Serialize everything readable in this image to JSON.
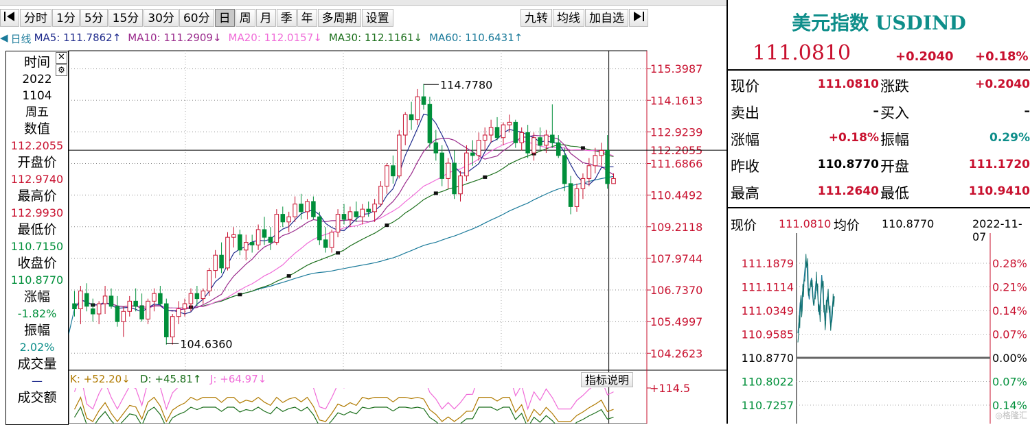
{
  "toolbar": {
    "nav_left_icon": "skip-to-start-icon",
    "periods": [
      "分时",
      "1分",
      "5分",
      "15分",
      "30分",
      "60分",
      "日",
      "周",
      "月",
      "季",
      "年",
      "多周期",
      "设置"
    ],
    "active_period": "日",
    "right_buttons": [
      "九转",
      "均线",
      "加自选"
    ],
    "nav_right_icon": "skip-to-end-icon"
  },
  "ma_legend": {
    "period_label": "日线",
    "items": [
      {
        "text": "MA5: 111.7862↑",
        "color": "#1e2a8c"
      },
      {
        "text": "MA10: 111.2909↓",
        "color": "#9a2a8c"
      },
      {
        "text": "MA20: 112.0157↓",
        "color": "#f06ad8"
      },
      {
        "text": "MA30: 112.1161↓",
        "color": "#1a6e1a"
      },
      {
        "text": "MA60: 110.6431↑",
        "color": "#1a7a9a"
      }
    ]
  },
  "info_panel": {
    "close_icon": "close-icon",
    "gear_icon": "gear-icon",
    "rows": [
      {
        "label": "时间",
        "value": "2022",
        "value_color": "#000000"
      },
      {
        "label": "",
        "value": "1104",
        "value_color": "#000000"
      },
      {
        "label": "",
        "value": "周五",
        "value_color": "#000000"
      },
      {
        "label": "数值",
        "value": "112.2055",
        "value_color": "#c8102e"
      },
      {
        "label": "开盘价",
        "value": "112.9740",
        "value_color": "#c8102e"
      },
      {
        "label": "最高价",
        "value": "112.9930",
        "value_color": "#c8102e"
      },
      {
        "label": "最低价",
        "value": "110.7150",
        "value_color": "#008f3a"
      },
      {
        "label": "收盘价",
        "value": "110.8770",
        "value_color": "#008f3a"
      },
      {
        "label": "涨幅",
        "value": "-1.82%",
        "value_color": "#008f3a"
      },
      {
        "label": "振幅",
        "value": "2.02%",
        "value_color": "#0e8e8a"
      },
      {
        "label": "成交量",
        "value": "—",
        "value_color": "#1e2a8c"
      },
      {
        "label": "成交额",
        "value": "",
        "value_color": "#000000"
      }
    ]
  },
  "price_axis_labels": [
    "115.3987",
    "114.1613",
    "112.9239",
    "112.2055",
    "111.6866",
    "110.4492",
    "109.2118",
    "107.9744",
    "106.7370",
    "105.4997",
    "104.2623"
  ],
  "lower_axis_label": "+114.5",
  "indicator_button": "指标说明",
  "kdj_legend": [
    {
      "text": "K: +52.20↓",
      "color": "#b07a00"
    },
    {
      "text": "D: +45.81↑",
      "color": "#1a6e1a"
    },
    {
      "text": "J: +64.97↓",
      "color": "#f06ad8"
    }
  ],
  "annotations": {
    "high": "114.7780",
    "low": "104.6360"
  },
  "price_panel": {
    "title": "美元指数 USDIND",
    "last_price": "111.0810",
    "change": "+0.2040",
    "change_pct": "+0.18%",
    "rows": [
      {
        "l1": "现价",
        "v1": "111.0810",
        "c1": "#c8102e",
        "l2": "涨跌",
        "v2": "+0.2040",
        "c2": "#c8102e"
      },
      {
        "l1": "卖出",
        "v1": "–",
        "c1": "#000000",
        "l2": "买入",
        "v2": "–",
        "c2": "#000000"
      },
      {
        "l1": "涨幅",
        "v1": "+0.18%",
        "c1": "#c8102e",
        "l2": "振幅",
        "v2": "0.29%",
        "c2": "#0e8e8a"
      },
      {
        "l1": "昨收",
        "v1": "110.8770",
        "c1": "#000000",
        "l2": "开盘",
        "v2": "111.1720",
        "c2": "#c8102e"
      },
      {
        "l1": "最高",
        "v1": "111.2640",
        "c1": "#c8102e",
        "l2": "最低",
        "v2": "110.9410",
        "c2": "#c8102e"
      }
    ],
    "minute_header": {
      "l1": "现价",
      "v1": "111.0810",
      "l2": "均价",
      "v2": "110.8770",
      "date": "2022-11-07"
    },
    "minute_left": [
      {
        "v": "111.1879",
        "c": "#c8102e"
      },
      {
        "v": "111.1114",
        "c": "#c8102e"
      },
      {
        "v": "111.0349",
        "c": "#c8102e"
      },
      {
        "v": "110.9585",
        "c": "#c8102e"
      },
      {
        "v": "110.8770",
        "c": "#000000"
      },
      {
        "v": "110.8022",
        "c": "#008f3a"
      },
      {
        "v": "110.7257",
        "c": "#008f3a"
      }
    ],
    "minute_right": [
      {
        "v": "0.28%",
        "c": "#c8102e"
      },
      {
        "v": "0.21%",
        "c": "#c8102e"
      },
      {
        "v": "0.14%",
        "c": "#c8102e"
      },
      {
        "v": "0.07%",
        "c": "#c8102e"
      },
      {
        "v": "0.00%",
        "c": "#000000"
      },
      {
        "v": "0.07%",
        "c": "#008f3a"
      },
      {
        "v": "0.14%",
        "c": "#008f3a"
      }
    ]
  },
  "chart_data": [
    {
      "type": "candlestick",
      "y_axis_ticks": [
        115.3987,
        114.1613,
        112.9239,
        111.6866,
        110.4492,
        109.2118,
        107.9744,
        106.737,
        105.4997,
        104.2623
      ],
      "ylim": [
        103.6,
        116.1
      ],
      "grid": true,
      "crosshair_value": 112.2055,
      "ohlc": [
        [
          106.2,
          106.7,
          105.7,
          106.0
        ],
        [
          106.0,
          106.9,
          105.4,
          106.7
        ],
        [
          106.6,
          107.0,
          105.9,
          106.1
        ],
        [
          106.0,
          106.4,
          105.5,
          105.8
        ],
        [
          105.8,
          106.3,
          105.4,
          106.2
        ],
        [
          106.2,
          106.9,
          105.8,
          106.5
        ],
        [
          106.5,
          106.8,
          106.0,
          106.1
        ],
        [
          106.1,
          106.5,
          105.3,
          105.5
        ],
        [
          105.5,
          106.1,
          104.9,
          105.9
        ],
        [
          105.9,
          106.5,
          105.7,
          106.3
        ],
        [
          106.3,
          106.8,
          105.9,
          106.1
        ],
        [
          106.1,
          106.6,
          105.5,
          105.6
        ],
        [
          105.6,
          106.4,
          105.4,
          106.3
        ],
        [
          106.3,
          106.8,
          105.9,
          106.6
        ],
        [
          106.6,
          106.9,
          106.1,
          106.2
        ],
        [
          106.2,
          106.4,
          104.6,
          104.9
        ],
        [
          104.9,
          105.8,
          104.6,
          105.7
        ],
        [
          105.7,
          106.3,
          105.4,
          106.0
        ],
        [
          106.0,
          106.4,
          105.7,
          106.2
        ],
        [
          106.2,
          106.8,
          105.9,
          106.6
        ],
        [
          106.6,
          106.9,
          106.1,
          106.4
        ],
        [
          106.4,
          106.8,
          106.2,
          106.7
        ],
        [
          106.7,
          107.6,
          106.5,
          107.5
        ],
        [
          107.5,
          108.3,
          107.2,
          108.1
        ],
        [
          108.1,
          108.6,
          107.4,
          107.6
        ],
        [
          107.6,
          109.0,
          107.5,
          108.8
        ],
        [
          108.8,
          109.2,
          108.4,
          108.9
        ],
        [
          108.9,
          109.1,
          108.1,
          108.3
        ],
        [
          108.3,
          108.9,
          107.9,
          108.6
        ],
        [
          108.6,
          108.9,
          108.2,
          108.5
        ],
        [
          108.5,
          109.3,
          108.3,
          109.1
        ],
        [
          109.1,
          109.6,
          108.5,
          108.8
        ],
        [
          108.8,
          109.2,
          108.3,
          108.6
        ],
        [
          108.6,
          109.9,
          108.5,
          109.7
        ],
        [
          109.7,
          110.0,
          109.2,
          109.4
        ],
        [
          109.4,
          109.8,
          109.0,
          109.6
        ],
        [
          109.6,
          110.4,
          109.4,
          110.1
        ],
        [
          110.1,
          110.5,
          109.5,
          109.8
        ],
        [
          109.8,
          110.3,
          109.5,
          110.2
        ],
        [
          110.2,
          110.4,
          109.5,
          109.6
        ],
        [
          109.6,
          109.8,
          108.5,
          108.7
        ],
        [
          108.7,
          109.2,
          108.2,
          108.4
        ],
        [
          108.4,
          109.1,
          108.2,
          109.0
        ],
        [
          109.0,
          109.9,
          108.8,
          109.7
        ],
        [
          109.7,
          110.1,
          109.3,
          109.5
        ],
        [
          109.5,
          110.0,
          109.2,
          109.8
        ],
        [
          109.8,
          110.2,
          109.4,
          109.6
        ],
        [
          109.6,
          110.1,
          109.3,
          109.9
        ],
        [
          109.9,
          110.2,
          109.6,
          109.8
        ],
        [
          109.8,
          110.3,
          109.4,
          110.1
        ],
        [
          110.1,
          111.0,
          110.0,
          110.8
        ],
        [
          110.8,
          111.7,
          110.5,
          111.6
        ],
        [
          111.6,
          112.0,
          110.9,
          111.2
        ],
        [
          111.2,
          113.0,
          111.1,
          112.8
        ],
        [
          112.8,
          113.7,
          112.4,
          113.6
        ],
        [
          113.6,
          114.1,
          113.0,
          113.4
        ],
        [
          113.4,
          114.6,
          113.2,
          114.3
        ],
        [
          114.3,
          114.8,
          113.8,
          114.0
        ],
        [
          114.0,
          114.3,
          112.3,
          112.5
        ],
        [
          112.5,
          113.0,
          111.8,
          112.1
        ],
        [
          112.1,
          112.4,
          110.8,
          111.1
        ],
        [
          111.1,
          111.9,
          110.7,
          111.7
        ],
        [
          111.7,
          112.2,
          110.3,
          110.5
        ],
        [
          110.5,
          111.4,
          110.2,
          111.2
        ],
        [
          111.2,
          112.4,
          111.0,
          112.1
        ],
        [
          112.1,
          112.6,
          111.6,
          112.0
        ],
        [
          112.0,
          112.9,
          111.8,
          112.6
        ],
        [
          112.6,
          113.1,
          112.2,
          112.8
        ],
        [
          112.8,
          113.4,
          112.5,
          113.1
        ],
        [
          113.1,
          113.5,
          112.6,
          112.7
        ],
        [
          112.7,
          113.3,
          112.4,
          113.2
        ],
        [
          113.2,
          113.6,
          112.9,
          113.3
        ],
        [
          113.3,
          113.4,
          112.3,
          112.5
        ],
        [
          112.5,
          113.1,
          112.2,
          112.9
        ],
        [
          112.9,
          113.2,
          111.9,
          112.1
        ],
        [
          112.1,
          112.9,
          111.8,
          112.7
        ],
        [
          112.7,
          113.1,
          112.2,
          112.4
        ],
        [
          112.4,
          113.0,
          112.1,
          112.8
        ],
        [
          112.8,
          114.0,
          112.3,
          112.5
        ],
        [
          112.5,
          112.8,
          111.9,
          112.0
        ],
        [
          112.0,
          112.3,
          110.6,
          110.9
        ],
        [
          110.9,
          111.2,
          109.7,
          110.0
        ],
        [
          110.0,
          110.9,
          109.8,
          110.7
        ],
        [
          110.7,
          111.3,
          110.3,
          111.1
        ],
        [
          111.1,
          111.9,
          110.8,
          111.6
        ],
        [
          111.6,
          112.3,
          111.3,
          112.0
        ],
        [
          112.0,
          112.5,
          111.6,
          112.2
        ],
        [
          112.2,
          112.8,
          110.7,
          110.9
        ],
        [
          110.9,
          111.3,
          110.9,
          111.1
        ]
      ],
      "annotations": {
        "high": 114.778,
        "low": 104.636
      }
    },
    {
      "type": "line",
      "name": "minute",
      "ylim": [
        110.7,
        111.22
      ],
      "values": [
        110.96,
        111.0,
        111.06,
        111.03,
        111.09,
        111.12,
        111.16,
        111.2,
        111.18,
        111.1,
        111.07,
        111.12,
        111.14,
        111.08,
        111.05,
        111.09,
        111.13,
        111.11,
        111.06,
        111.02,
        111.08,
        111.15,
        111.1,
        111.04,
        111.0,
        111.05,
        111.08,
        111.06,
        111.02,
        110.98,
        111.03,
        111.07,
        111.08
      ]
    }
  ]
}
